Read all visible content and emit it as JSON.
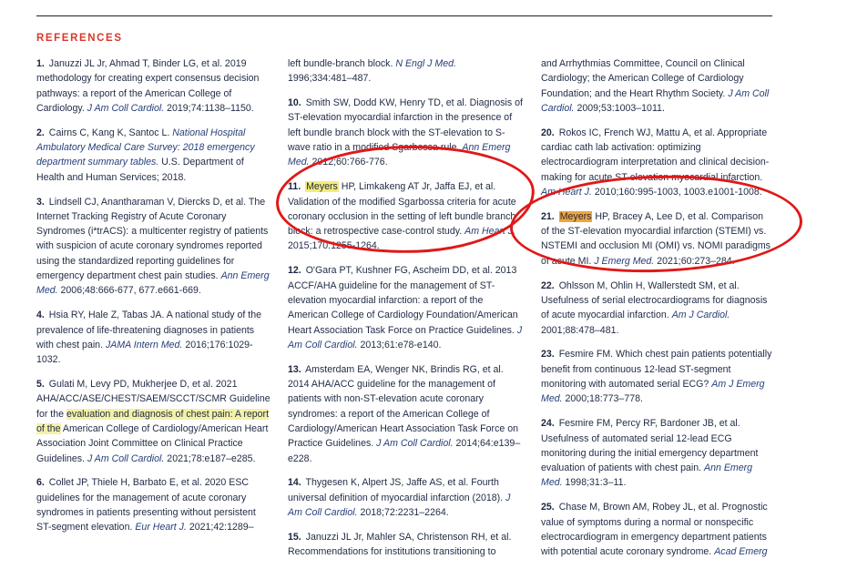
{
  "heading": "REFERENCES",
  "refs": {
    "r1": {
      "num": "1.",
      "pre": "Januzzi JL Jr, Ahmad T, Binder LG, et al. 2019 methodology for creating expert consensus decision pathways: a report of the American College of Cardiology.",
      "j": "J Am Coll Cardiol.",
      "post": "2019;74:1138–1150."
    },
    "r2": {
      "num": "2.",
      "pre": "Cairns C, Kang K, Santoc L.",
      "j": "National Hospital Ambulatory Medical Care Survey: 2018 emergency department summary tables.",
      "post": "U.S. Department of Health and Human Services; 2018."
    },
    "r3": {
      "num": "3.",
      "pre": "Lindsell CJ, Anantharaman V, Diercks D, et al. The Internet Tracking Registry of Acute Coronary Syndromes (i*trACS): a multicenter registry of patients with suspicion of acute coronary syndromes reported using the standardized reporting guidelines for emergency department chest pain studies.",
      "j": "Ann Emerg Med.",
      "post": "2006;48:666-677, 677.e661-669."
    },
    "r4": {
      "num": "4.",
      "pre": "Hsia RY, Hale Z, Tabas JA. A national study of the prevalence of life-threatening diagnoses in patients with chest pain.",
      "j": "JAMA Intern Med.",
      "post": "2016;176:1029-1032."
    },
    "r5": {
      "num": "5.",
      "pre": "Gulati M, Levy PD, Mukherjee D, et al. 2021 AHA/ACC/ASE/CHEST/SAEM/SCCT/SCMR Guideline for the",
      "hl": "evaluation and diagnosis of chest pain: A report of the",
      "pre2": "American College of Cardiology/American Heart Association Joint Committee on Clinical Practice Guidelines.",
      "j": "J Am Coll Cardiol.",
      "post": "2021;78:e187–e285."
    },
    "r6": {
      "num": "6.",
      "pre": "Collet JP, Thiele H, Barbato E, et al. 2020 ESC guidelines for the management of acute coronary syndromes in patients presenting without persistent ST-segment elevation.",
      "j": "Eur Heart J.",
      "post": "2021;42:1289–"
    },
    "c2top": {
      "pre": "left bundle-branch block.",
      "j": "N Engl J Med.",
      "post": "1996;334:481–487."
    },
    "r10": {
      "num": "10.",
      "pre": "Smith SW, Dodd KW, Henry TD, et al. Diagnosis of ST-elevation myocardial infarction in the presence of left bundle branch block with the ST-elevation to S-wave ratio in a modified Sgarbossa rule.",
      "j": "Ann Emerg Med.",
      "post": "2012;60:766-776."
    },
    "r11": {
      "num": "11.",
      "hl": "Meyers",
      "pre": "HP, Limkakeng AT Jr, Jaffa EJ, et al. Validation of the modified Sgarbossa criteria for acute coronary occlusion in the setting of left bundle branch block: a retrospective case-control study.",
      "j": "Am Heart J.",
      "post": "2015;170:1255-1264."
    },
    "r12": {
      "num": "12.",
      "pre": "O'Gara PT, Kushner FG, Ascheim DD, et al. 2013 ACCF/AHA guideline for the management of ST-elevation myocardial infarction: a report of the American College of Cardiology Foundation/American Heart Association Task Force on Practice Guidelines.",
      "j": "J Am Coll Cardiol.",
      "post": "2013;61:e78-e140."
    },
    "r13": {
      "num": "13.",
      "pre": "Amsterdam EA, Wenger NK, Brindis RG, et al. 2014 AHA/ACC guideline for the management of patients with non-ST-elevation acute coronary syndromes: a report of the American College of Cardiology/American Heart Association Task Force on Practice Guidelines.",
      "j": "J Am Coll Cardiol.",
      "post": "2014;64:e139–e228."
    },
    "r14": {
      "num": "14.",
      "pre": "Thygesen K, Alpert JS, Jaffe AS, et al. Fourth universal definition of myocardial infarction (2018).",
      "j": "J Am Coll Cardiol.",
      "post": "2018;72:2231–2264."
    },
    "r15": {
      "num": "15.",
      "pre": "Januzzi JL Jr, Mahler SA, Christenson RH, et al. Recommendations for institutions transitioning to"
    },
    "c3top": {
      "pre": "and Arrhythmias Committee, Council on Clinical Cardiology; the American College of Cardiology Foundation; and the Heart Rhythm Society.",
      "j": "J Am Coll Cardiol.",
      "post": "2009;53:1003–1011."
    },
    "r20": {
      "num": "20.",
      "pre": "Rokos IC, French WJ, Mattu A, et al. Appropriate cardiac cath lab activation: optimizing electrocardiogram interpretation and clinical decision-making for acute ST-elevation myocardial infarction.",
      "j": "Am Heart J.",
      "post": "2010;160:995-1003, 1003.e1001-1008."
    },
    "r21": {
      "num": "21.",
      "hl": "Meyers",
      "pre": "HP, Bracey A, Lee D, et al. Comparison of the ST-elevation myocardial infarction (STEMI) vs. NSTEMI and occlusion MI (OMI) vs. NOMI paradigms of acute MI.",
      "j": "J Emerg Med.",
      "post": "2021;60:273–284."
    },
    "r22": {
      "num": "22.",
      "pre": "Ohlsson M, Ohlin H, Wallerstedt SM, et al. Usefulness of serial electrocardiograms for diagnosis of acute myocardial infarction.",
      "j": "Am J Cardiol.",
      "post": "2001;88:478–481."
    },
    "r23": {
      "num": "23.",
      "pre": "Fesmire FM. Which chest pain patients potentially benefit from continuous 12-lead ST-segment monitoring with automated serial ECG?",
      "j": "Am J Emerg Med.",
      "post": "2000;18:773–778."
    },
    "r24": {
      "num": "24.",
      "pre": "Fesmire FM, Percy RF, Bardoner JB, et al. Usefulness of automated serial 12-lead ECG monitoring during the initial emergency department evaluation of patients with chest pain.",
      "j": "Ann Emerg Med.",
      "post": "1998;31:3–11."
    },
    "r25": {
      "num": "25.",
      "pre": "Chase M, Brown AM, Robey JL, et al. Prognostic value of symptoms during a normal or nonspecific electrocardiogram in emergency department patients with potential acute coronary syndrome.",
      "j": "Acad Emerg"
    }
  },
  "colors": {
    "heading": "#d5392c",
    "yellow_highlight": "#f5ec7a",
    "orange_highlight": "#f2a43a",
    "red_ink": "#e01818",
    "journal": "#27407a"
  }
}
